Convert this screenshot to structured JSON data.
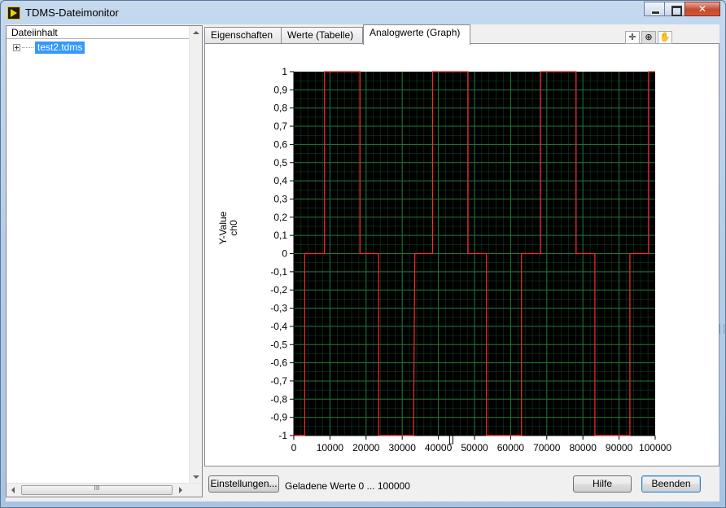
{
  "window": {
    "title": "TDMS-Dateimonitor"
  },
  "tree": {
    "header": "Dateiinhalt",
    "items": [
      {
        "label": "test2.tdms",
        "selected": true
      }
    ]
  },
  "tabs": [
    {
      "label": "Eigenschaften",
      "active": false
    },
    {
      "label": "Werte (Tabelle)",
      "active": false
    },
    {
      "label": "Analogwerte (Graph)",
      "active": true
    }
  ],
  "graph": {
    "ylabel_line1": "Y-Value",
    "ylabel_line2": "ch0",
    "xlabel": "[]",
    "tools": [
      "cursor-icon",
      "zoom-icon",
      "pan-hand-icon"
    ],
    "colors": {
      "plot_bg": "#000000",
      "grid": "#1f7a3a",
      "trace": "#ff2a2a"
    }
  },
  "chart_data": {
    "type": "line",
    "title": "",
    "xlabel": "[]",
    "ylabel": "Y-Value ch0",
    "xlim": [
      0,
      100000
    ],
    "ylim": [
      -1,
      1
    ],
    "x_ticks": [
      "0",
      "10000",
      "20000",
      "30000",
      "40000",
      "50000",
      "60000",
      "70000",
      "80000",
      "90000",
      "100000"
    ],
    "y_ticks": [
      "1",
      "0,9",
      "0,8",
      "0,7",
      "0,6",
      "0,5",
      "0,4",
      "0,3",
      "0,2",
      "0,1",
      "0",
      "-0,1",
      "-0,2",
      "-0,3",
      "-0,4",
      "-0,5",
      "-0,6",
      "-0,7",
      "-0,8",
      "-0,9",
      "-1"
    ],
    "grid": true,
    "series": [
      {
        "x": [
          0,
          3000,
          3000,
          3400,
          3400,
          8500,
          8500,
          18300,
          18300,
          23500,
          23500,
          33100,
          33100,
          33500,
          33500,
          38400,
          38400,
          48200,
          48200,
          53300,
          53300,
          63000,
          63000,
          68300,
          68300,
          78100,
          78100,
          83300,
          83300,
          93000,
          93000,
          98200,
          98200,
          100000
        ],
        "y": [
          -1,
          -1,
          0,
          0,
          0,
          0,
          1,
          1,
          0,
          0,
          -1,
          -1,
          -1,
          0,
          0,
          0,
          1,
          1,
          0,
          0,
          -1,
          -1,
          0,
          0,
          1,
          1,
          0,
          0,
          -1,
          -1,
          0,
          0,
          1,
          1
        ]
      }
    ]
  },
  "bottom": {
    "settings_label": "Einstellungen...",
    "loaded_text": "Geladene Werte 0 ... 100000",
    "help_label": "Hilfe",
    "exit_label": "Beenden"
  }
}
